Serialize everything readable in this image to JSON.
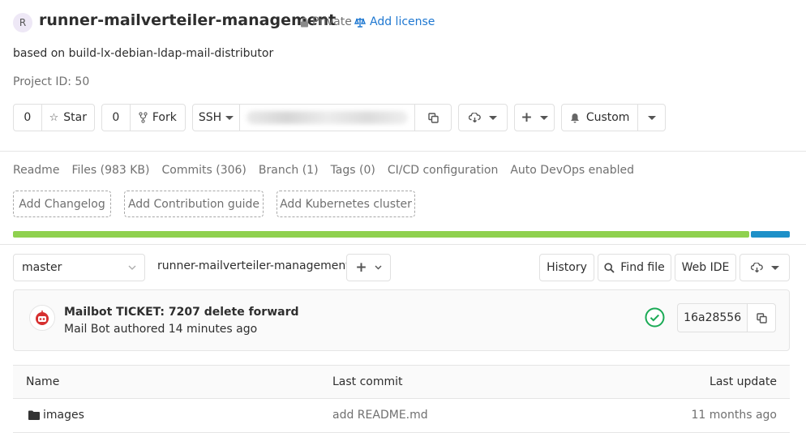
{
  "project": {
    "avatar_letter": "R",
    "name": "runner-mailverteiler-management",
    "visibility": "Private",
    "add_license": "Add license",
    "description": "based on build-lx-debian-ldap-mail-distributor",
    "project_id": "Project ID: 50"
  },
  "actions": {
    "star_count": "0",
    "star_label": "Star",
    "fork_count": "0",
    "fork_label": "Fork",
    "clone_protocol": "SSH",
    "notification_label": "Custom"
  },
  "stats": {
    "readme": "Readme",
    "files": "Files (983 KB)",
    "commits": "Commits (306)",
    "branch": "Branch (1)",
    "tags": "Tags (0)",
    "cicd": "CI/CD configuration",
    "autodevops": "Auto DevOps enabled"
  },
  "quick_add": {
    "changelog": "Add Changelog",
    "contribution": "Add Contribution guide",
    "kubernetes": "Add Kubernetes cluster"
  },
  "language_bar": {
    "segments": [
      {
        "fraction": 0.95,
        "color": "#8fd14f"
      },
      {
        "fraction": 0.05,
        "color": "#1e90c8"
      }
    ]
  },
  "tree": {
    "branch": "master",
    "path": "runner-mailverteiler-management",
    "separator": "/",
    "history": "History",
    "find_file": "Find file",
    "web_ide": "Web IDE"
  },
  "last_commit": {
    "title": "Mailbot TICKET: 7207 delete forward",
    "author_line": "Mail Bot authored 14 minutes ago",
    "sha": "16a28556",
    "status_color": "#1aaa55"
  },
  "files_table": {
    "headers": {
      "name": "Name",
      "last_commit": "Last commit",
      "last_update": "Last update"
    },
    "rows": [
      {
        "name": "images",
        "commit": "add README.md",
        "updated": "11 months ago"
      }
    ]
  }
}
